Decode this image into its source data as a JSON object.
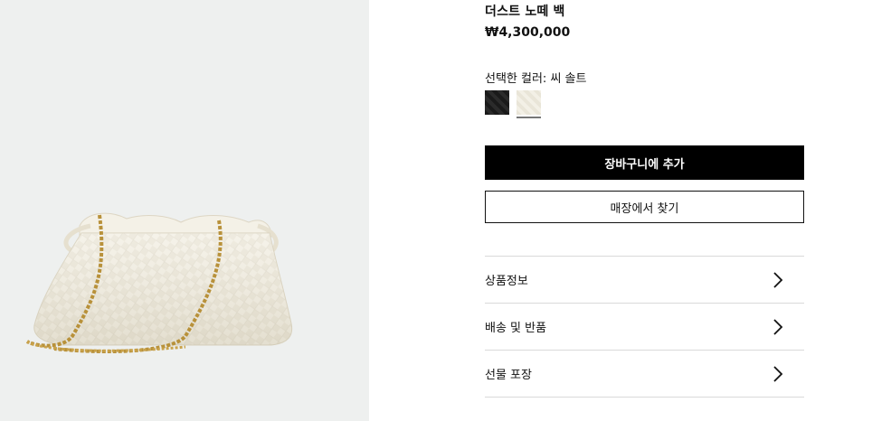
{
  "product": {
    "title": "더스트 노떼 백",
    "price": "₩4,300,000",
    "image_alt": "크림 색상 인트레치아토 위빙 파우치 백, 골드 체인 스트랩"
  },
  "color": {
    "label": "선택한 컬러: 씨 솔트",
    "swatches": [
      {
        "name": "black",
        "color": "#1f1f1f",
        "selected": false
      },
      {
        "name": "sea salt",
        "color": "#ece8dc",
        "selected": true
      }
    ]
  },
  "actions": {
    "add_to_cart": "장바구니에 추가",
    "find_in_store": "매장에서 찾기"
  },
  "accordion": [
    {
      "label": "상품정보",
      "icon": "chevron-right-icon"
    },
    {
      "label": "배송 및 반품",
      "icon": "chevron-right-icon"
    },
    {
      "label": "선물 포장",
      "icon": "chevron-right-icon"
    }
  ],
  "colors": {
    "image_background": "#eef0ef",
    "bag_cream": "#f2eee2",
    "chain_gold": "#b8913a",
    "primary_button": "#000000"
  }
}
